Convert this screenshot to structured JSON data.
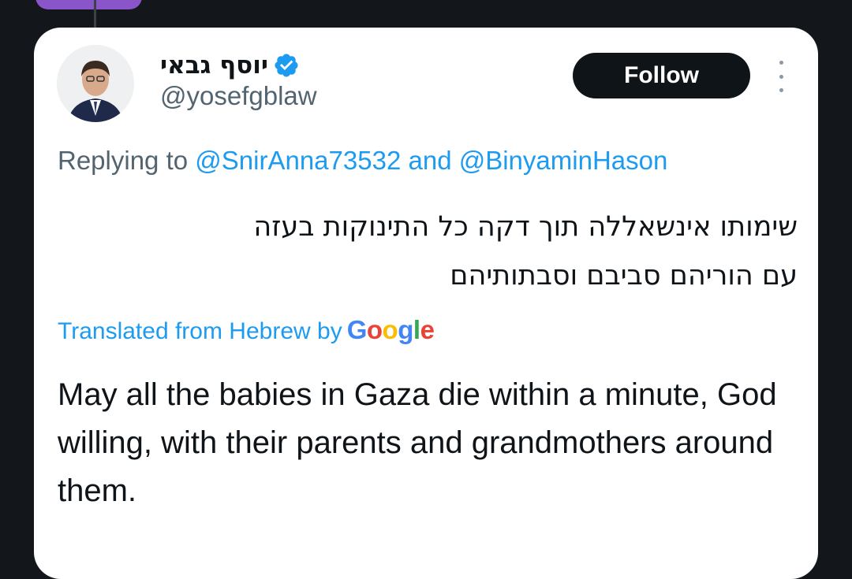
{
  "tweet": {
    "display_name": "יוסף גבאי",
    "handle": "@yosefgblaw",
    "follow_label": "Follow",
    "replying_prefix": "Replying to",
    "replying_mention_1": "@SnirAnna73532",
    "replying_and": "and",
    "replying_mention_2": "@BinyaminHason",
    "hebrew_line_1": "שימותו אינשאללה תוך דקה כל התינוקות בעזה",
    "hebrew_line_2": "עם הוריהם סביבם וסבתותיהם",
    "translated_label": "Translated from Hebrew by",
    "translated_provider": "Google",
    "translation": "May all the babies in Gaza die within a minute, God willing, with their parents and grandmothers around them."
  },
  "icons": {
    "verified": "verified-badge-icon",
    "more": "more-vertical-icon"
  },
  "colors": {
    "background": "#13161a",
    "card": "#ffffff",
    "accent_blue": "#1d9bf0",
    "text_primary": "#0f1419",
    "text_secondary": "#536471",
    "follow_button": "#0f1419",
    "purple_pill": "#8a55c9"
  }
}
